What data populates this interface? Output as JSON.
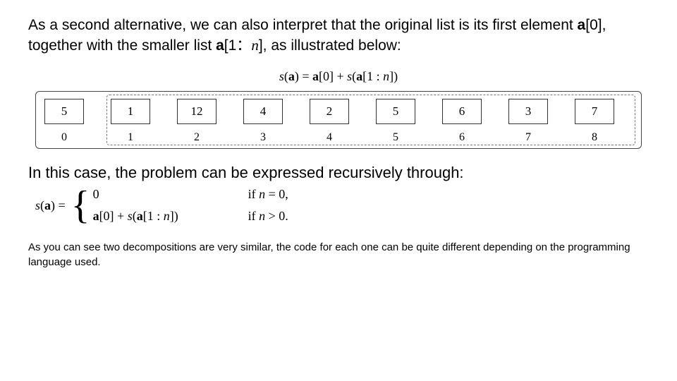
{
  "intro": {
    "lead": "As a second alternative, we can also interpret that the original list is its first element ",
    "a0": "a",
    "a0_sub": "[0]",
    "mid": ", together with the smaller list ",
    "a1n_a": "a",
    "a1n_open": "[1：",
    "a1n_n": "n",
    "a1n_close": "]",
    "tail": ", as illustrated below:"
  },
  "formula_top": {
    "s": "s",
    "open": "(",
    "a": "a",
    "close": ") = ",
    "a0": "a",
    "a0_idx": "[0] + ",
    "s2": "s",
    "open2": "(",
    "a2": "a",
    "slice": "[1 : ",
    "n": "n",
    "close2": "])"
  },
  "diagram": {
    "values": [
      "5",
      "1",
      "12",
      "4",
      "2",
      "5",
      "6",
      "3",
      "7"
    ],
    "indices": [
      "0",
      "1",
      "2",
      "3",
      "4",
      "5",
      "6",
      "7",
      "8"
    ]
  },
  "mid_text": "In this case, the problem can be expressed recursively through:",
  "formula_cases": {
    "lhs_s": "s",
    "lhs_open": "(",
    "lhs_a": "a",
    "lhs_close": ") = ",
    "case0_expr": "0",
    "case0_cond_if": "if ",
    "case0_cond_n": "n",
    "case0_cond_rest": " = 0,",
    "case1_a": "a",
    "case1_a0": "[0] + ",
    "case1_s": "s",
    "case1_open": "(",
    "case1_a2": "a",
    "case1_slice": "[1 : ",
    "case1_n": "n",
    "case1_close": "])",
    "case1_cond_if": "if ",
    "case1_cond_n": "n",
    "case1_cond_rest": " > 0."
  },
  "note": "As you can see two  decompositions are very similar, the code for each one can be quite different depending on the programming language used."
}
